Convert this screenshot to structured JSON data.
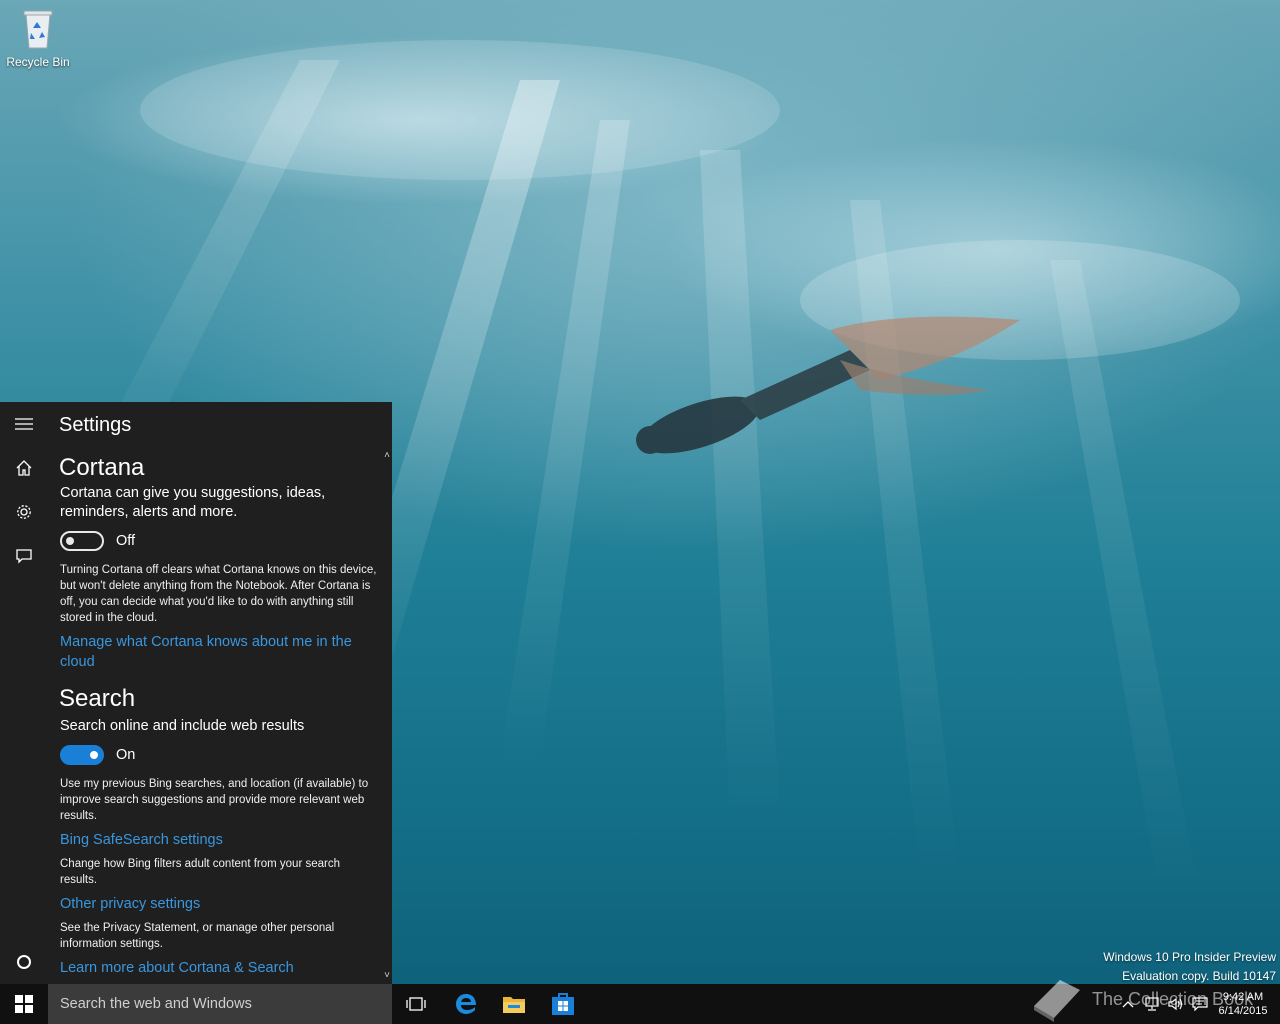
{
  "desktop": {
    "recycle_bin_label": "Recycle Bin",
    "watermark_line1": "Windows 10 Pro Insider Preview",
    "watermark_line2": "Evaluation copy. Build 10147"
  },
  "panel": {
    "title": "Settings",
    "rail": [
      {
        "name": "menu-icon"
      },
      {
        "name": "home-icon"
      },
      {
        "name": "gear-icon"
      },
      {
        "name": "feedback-icon"
      },
      {
        "name": "cortana-circle-icon"
      }
    ],
    "cortana": {
      "heading": "Cortana",
      "description": "Cortana can give you suggestions, ideas, reminders, alerts and more.",
      "toggle_state": "Off",
      "toggle_on": false,
      "note": "Turning Cortana off clears what Cortana knows on this device, but won't delete anything from the Notebook. After Cortana is off, you can decide what you'd like to do with anything still stored in the cloud.",
      "link": "Manage what Cortana knows about me in the cloud"
    },
    "search": {
      "heading": "Search",
      "description": "Search online and include web results",
      "toggle_state": "On",
      "toggle_on": true,
      "note": "Use my previous Bing searches, and location (if available) to improve search suggestions and provide more relevant web results.",
      "safesearch_link": "Bing SafeSearch settings",
      "safesearch_note": "Change how Bing filters adult content from your search results.",
      "privacy_link": "Other privacy settings",
      "privacy_note": "See the Privacy Statement, or manage other personal information settings.",
      "learn_link": "Learn more about Cortana & Search"
    }
  },
  "taskbar": {
    "search_placeholder": "Search the web and Windows",
    "apps": [
      {
        "name": "task-view-icon"
      },
      {
        "name": "edge-icon"
      },
      {
        "name": "file-explorer-icon"
      },
      {
        "name": "store-icon"
      }
    ],
    "clock_time": "9:42 AM",
    "clock_date": "6/14/2015",
    "watermark_text": "The Collection Book"
  },
  "colors": {
    "panel_bg": "#1f1f1f",
    "accent": "#1a7fd6",
    "link": "#3a96dd",
    "taskbar_bg": "#101010",
    "search_bg": "#3b3b3b"
  }
}
